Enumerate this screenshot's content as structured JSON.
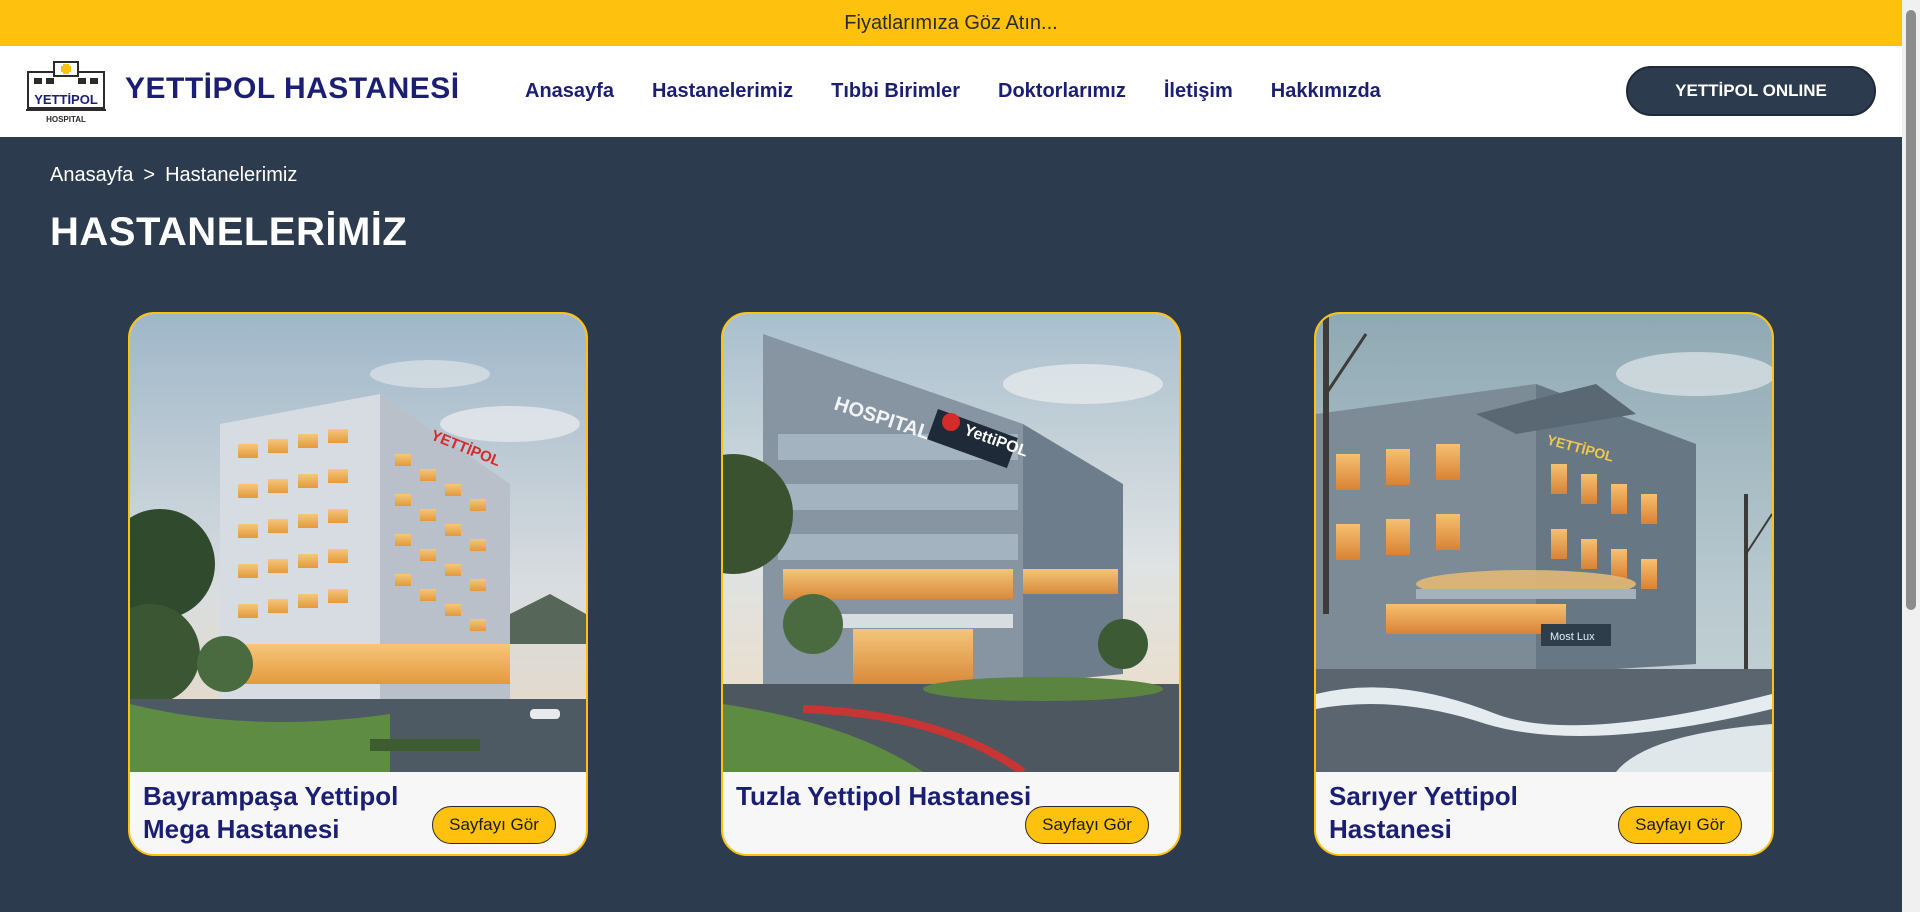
{
  "promo": {
    "text": "Fiyatlarımıza Göz Atın..."
  },
  "header": {
    "logo_text": "YETTİPOL",
    "logo_subtext": "HOSPITAL",
    "brand_title": "YETTİPOL HASTANESİ",
    "nav": [
      {
        "label": "Anasayfa"
      },
      {
        "label": "Hastanelerimiz"
      },
      {
        "label": "Tıbbi Birimler"
      },
      {
        "label": "Doktorlarımız"
      },
      {
        "label": "İletişim"
      },
      {
        "label": "Hakkımızda"
      }
    ],
    "online_button": "YETTİPOL ONLINE"
  },
  "breadcrumb": {
    "home": "Anasayfa",
    "separator": ">",
    "current": "Hastanelerimiz"
  },
  "page_title": "HASTANELERİMİZ",
  "cards": [
    {
      "title": "Bayrampaşa Yettipol Mega Hastanesi",
      "button": "Sayfayı Gör",
      "sign": "YETTİPOL"
    },
    {
      "title": "Tuzla Yettipol Hastanesi",
      "button": "Sayfayı Gör",
      "sign": "YettiPOL",
      "sign2": "HOSPITAL"
    },
    {
      "title": "Sarıyer Yettipol Hastanesi",
      "button": "Sayfayı Gör",
      "sign": "YETTİPOL",
      "sign2": "Most Lux"
    }
  ],
  "colors": {
    "accent_yellow": "#fec10d",
    "navy": "#1b1f74",
    "page_bg": "#2d3b4e"
  }
}
